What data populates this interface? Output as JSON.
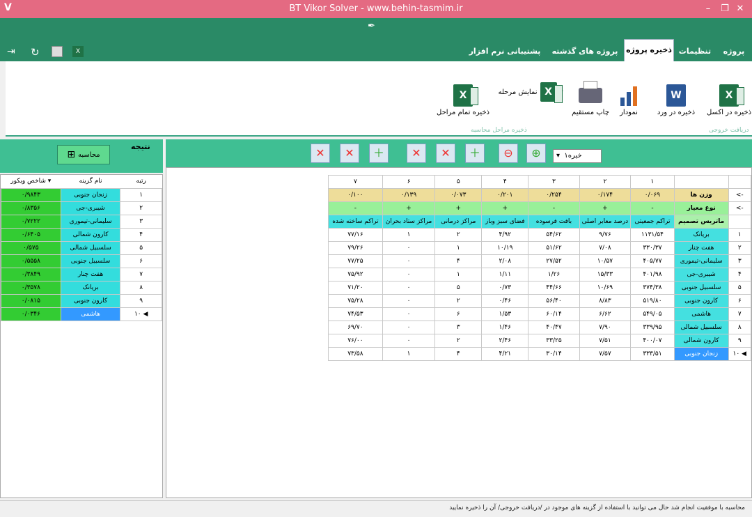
{
  "window": {
    "title": "BT Vikor Solver - www.behin-tasmim.ir",
    "app_logo": "V"
  },
  "tabs": [
    {
      "label": "پروژه جدید"
    },
    {
      "label": "تنظیمات"
    },
    {
      "label": "ذخیره پروژه"
    },
    {
      "label": "پروژه های گذشته"
    },
    {
      "label": "پشتیبانی نرم افزار"
    }
  ],
  "ribbon": {
    "save_excel": "ذخیره در اکسل",
    "save_word": "ذخیره در ورد",
    "chart": "نمودار",
    "print": "چاپ مستقیم",
    "show_stage": "نمایش مرحله",
    "save_all_stages": "ذخیره تمام مراحل",
    "group_output": "دریافت خروجی",
    "group_stages": "ذخیره مراحل محاسبه"
  },
  "left": {
    "result_title": "نتیجه",
    "calc_button": "محاسبه",
    "col_rank": "رتبه",
    "col_name": "نام گزینه",
    "col_index": "شاخص ویکور",
    "rows": [
      {
        "rank": "۱",
        "name": "زنجان جنوبی",
        "val": "۰/۹۸۴۳"
      },
      {
        "rank": "۲",
        "name": "شیبری-جی",
        "val": "۰/۸۳۵۶"
      },
      {
        "rank": "۳",
        "name": "سلیمانی-تیموری",
        "val": "۰/۷۲۲۲"
      },
      {
        "rank": "۴",
        "name": "کارون شمالی",
        "val": "۰/۶۴۰۵"
      },
      {
        "rank": "۵",
        "name": "سلسبیل شمالی",
        "val": "۰/۵۷۵"
      },
      {
        "rank": "۶",
        "name": "سلسبیل جنوبی",
        "val": "۰/۵۵۵۸"
      },
      {
        "rank": "۷",
        "name": "هفت چنار",
        "val": "۰/۳۸۴۹"
      },
      {
        "rank": "۸",
        "name": "بریانک",
        "val": "۰/۳۵۷۸"
      },
      {
        "rank": "۹",
        "name": "کارون جنوبی",
        "val": "۰/۰۸۱۵"
      },
      {
        "rank": "۱۰",
        "name": "هاشمی",
        "val": "۰/۰۳۴۶"
      }
    ]
  },
  "toolbar": {
    "expert_select": "خبره۱"
  },
  "matrix": {
    "col_numbers": [
      "۷",
      "۶",
      "۵",
      "۴",
      "۳",
      "۲",
      "۱"
    ],
    "weights_label": "وزن ها",
    "weights": [
      "۰/۱۰۰",
      "۰/۱۳۹",
      "۰/۰۷۳",
      "۰/۲۰۱",
      "۰/۲۵۴",
      "۰/۱۷۴",
      "۰/۰۶۹"
    ],
    "type_label": "نوع معیار",
    "types": [
      "-",
      "+",
      "+",
      "+",
      "-",
      "+",
      "-"
    ],
    "matrix_label": "ماتریس تصمیم",
    "headers": [
      "تراکم ساخته شده",
      "مراکز ستاد بحران",
      "مراکز درمانی",
      "فضای سبز وباز",
      "بافت فرسوده",
      "درصد معابر اصلی",
      "تراکم جمعیتی"
    ],
    "arrow": "<-",
    "rows": [
      {
        "n": "۱",
        "name": "بریانک",
        "cells": [
          "۷۷/۱۶",
          "۱",
          "۲",
          "۴/۹۲",
          "۵۴/۶۲",
          "۹/۷۶",
          "۱۱۳۱/۵۴"
        ]
      },
      {
        "n": "۲",
        "name": "هفت چنار",
        "cells": [
          "۷۹/۲۶",
          "۰",
          "۱",
          "۱۰/۱۹",
          "۵۱/۶۲",
          "۷/۰۸",
          "۳۳۰/۳۷"
        ]
      },
      {
        "n": "۳",
        "name": "سلیمانی-تیموری",
        "cells": [
          "۷۷/۲۵",
          "۰",
          "۴",
          "۲/۰۸",
          "۲۷/۵۲",
          "۱۰/۵۷",
          "۴۰۵/۷۷"
        ]
      },
      {
        "n": "۴",
        "name": "شیبری-جی",
        "cells": [
          "۷۵/۹۲",
          "۰",
          "۱",
          "۱/۱۱",
          "۱/۲۶",
          "۱۵/۳۳",
          "۴۰۱/۹۸"
        ]
      },
      {
        "n": "۵",
        "name": "سلسبیل جنوبی",
        "cells": [
          "۷۱/۲۰",
          "۰",
          "۵",
          "۰/۷۳",
          "۴۴/۶۶",
          "۱۰/۶۹",
          "۳۷۴/۳۸"
        ]
      },
      {
        "n": "۶",
        "name": "کارون جنوبی",
        "cells": [
          "۷۵/۲۸",
          "۰",
          "۲",
          "۰/۴۶",
          "۵۶/۴۰",
          "۸/۸۳",
          "۵۱۹/۸۰"
        ]
      },
      {
        "n": "۷",
        "name": "هاشمی",
        "cells": [
          "۷۴/۵۳",
          "۰",
          "۶",
          "۱/۵۳",
          "۶۰/۱۴",
          "۶/۶۲",
          "۵۴۹/۰۵"
        ]
      },
      {
        "n": "۸",
        "name": "سلسبیل شمالی",
        "cells": [
          "۶۹/۷۰",
          "۰",
          "۳",
          "۱/۴۶",
          "۴۰/۴۷",
          "۷/۹۰",
          "۳۳۹/۹۵"
        ]
      },
      {
        "n": "۹",
        "name": "کارون شمالی",
        "cells": [
          "۷۶/۰۰",
          "۰",
          "۲",
          "۲/۴۶",
          "۳۳/۲۵",
          "۷/۵۱",
          "۴۰۰/۰۷"
        ]
      },
      {
        "n": "۱۰",
        "name": "زنجان جنوبی",
        "cells": [
          "۷۳/۵۸",
          "۱",
          "۴",
          "۴/۲۱",
          "۳۰/۱۴",
          "۷/۵۷",
          "۳۳۳/۵۱"
        ]
      }
    ]
  },
  "status": "محاسبه با موفقیت انجام شد حال می توانید با استفاده از گزینه های موجود در /دریافت خروجی/ آن را ذخیره نمایید"
}
